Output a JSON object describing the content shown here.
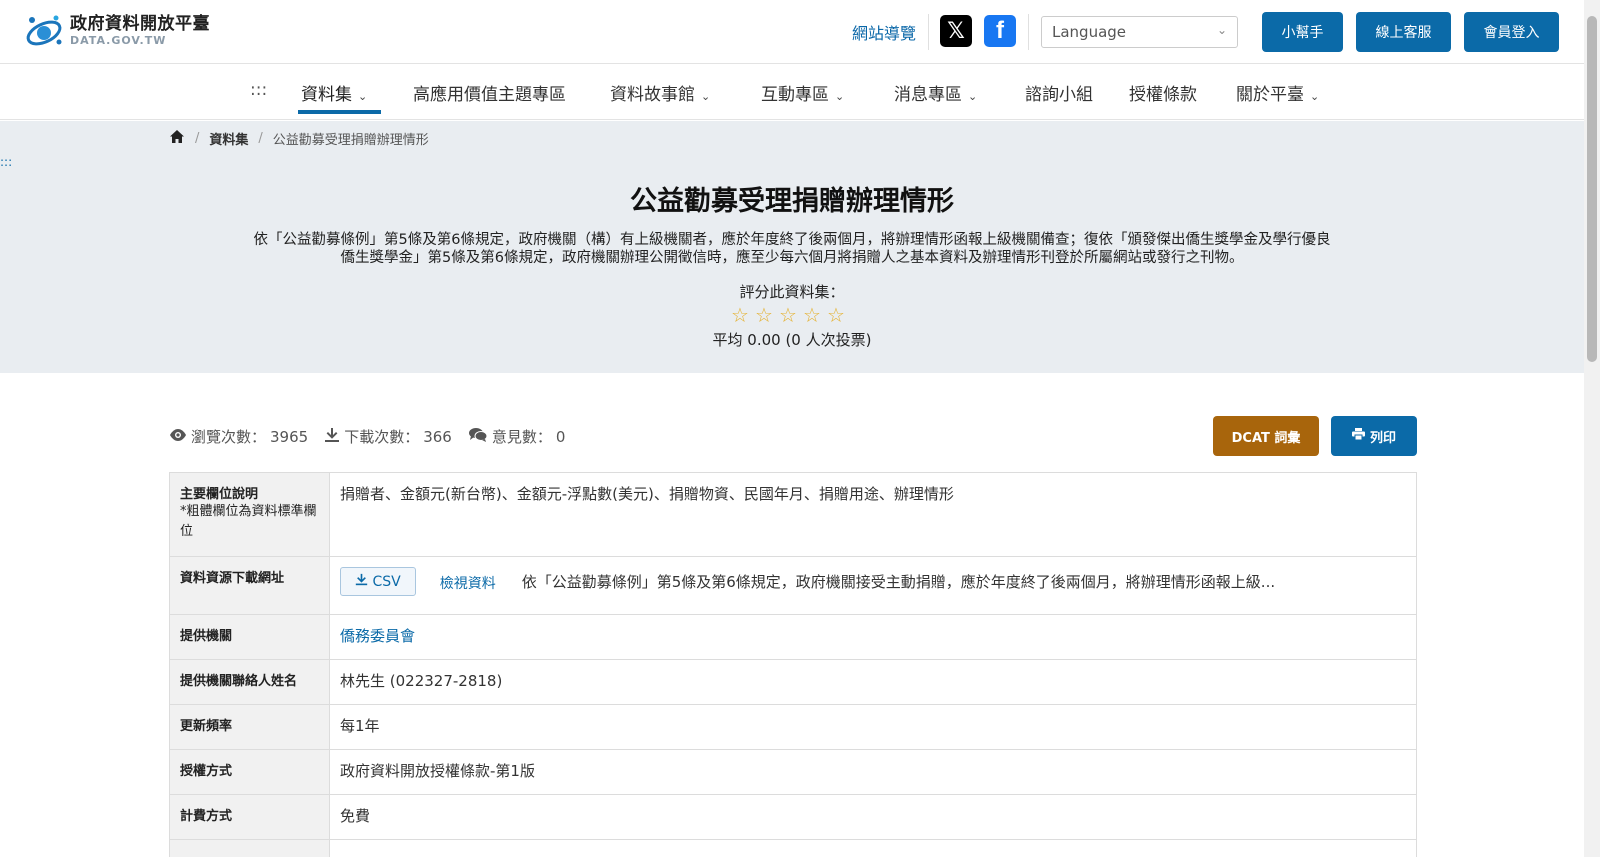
{
  "header": {
    "logo_title": "政府資料開放平臺",
    "logo_sub": "DATA.GOV.TW",
    "sitemap": "網站導覽",
    "social_x": "𝕏",
    "social_fb": "f",
    "language_placeholder": "Language",
    "buttons": [
      "小幫手",
      "線上客服",
      "會員登入"
    ]
  },
  "nav": {
    "accesskey": ":::",
    "items": [
      {
        "label": "資料集",
        "dropdown": true
      },
      {
        "label": "高應用價值主題專區",
        "dropdown": false
      },
      {
        "label": "資料故事館",
        "dropdown": true
      },
      {
        "label": "互動專區",
        "dropdown": true
      },
      {
        "label": "消息專區",
        "dropdown": true
      },
      {
        "label": "諮詢小組",
        "dropdown": false
      },
      {
        "label": "授權條款",
        "dropdown": false
      },
      {
        "label": "關於平臺",
        "dropdown": true
      }
    ]
  },
  "breadcrumb": {
    "home_icon": "home-icon",
    "level1": "資料集",
    "current": "公益勸募受理捐贈辦理情形"
  },
  "hero": {
    "accesskey": ":::",
    "title": "公益勸募受理捐贈辦理情形",
    "description": "依「公益勸募條例」第5條及第6條規定，政府機關（構）有上級機關者，應於年度終了後兩個月，將辦理情形函報上級機關備查；復依「頒發傑出僑生獎學金及學行優良僑生獎學金」第5條及第6條規定，政府機關辦理公開徵信時，應至少每六個月將捐贈人之基本資料及辦理情形刊登於所屬網站或發行之刊物。",
    "rate_label": "評分此資料集：",
    "stars_filled": 0,
    "stars_total": 5,
    "average": "平均 0.00 (0 人次投票)"
  },
  "stats": {
    "views_label": "瀏覽次數：",
    "views": "3965",
    "downloads_label": "下載次數：",
    "downloads": "366",
    "comments_label": "意見數：",
    "comments": "0"
  },
  "actions": {
    "dcat": "DCAT 詞彙",
    "print": "列印"
  },
  "info": {
    "fields_label": "主要欄位說明",
    "fields_note": "*粗體欄位為資料標準欄位",
    "fields_value": "捐贈者、金額元(新台幣)、金額元-浮點數(美元)、捐贈物資、民國年月、捐贈用途、辦理情形",
    "resource_label": "資料資源下載網址",
    "csv_label": "CSV",
    "view_label": "檢視資料",
    "resource_desc": "依「公益勸募條例」第5條及第6條規定，政府機關接受主動捐贈，應於年度終了後兩個月，將辦理情形函報上級...",
    "agency_label": "提供機關",
    "agency_value": "僑務委員會",
    "contact_label": "提供機關聯絡人姓名",
    "contact_value": "林先生 (022327-2818)",
    "frequency_label": "更新頻率",
    "frequency_value": "每1年",
    "license_label": "授權方式",
    "license_value": "政府資料開放授權條款-第1版",
    "fee_label": "計費方式",
    "fee_value": "免費"
  }
}
